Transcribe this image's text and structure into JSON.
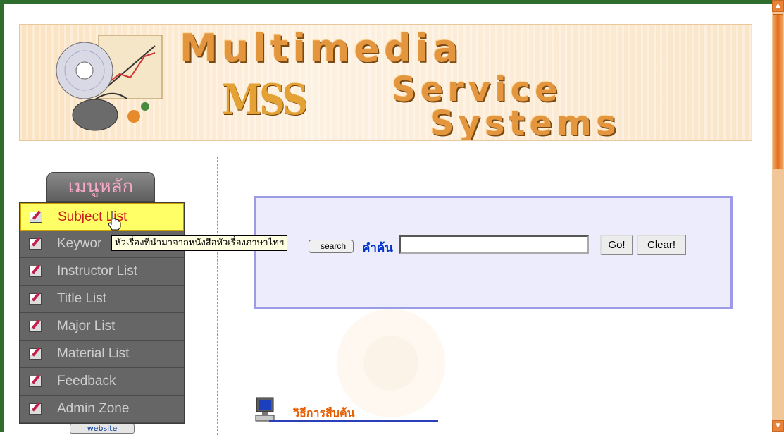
{
  "banner": {
    "word_multimedia": "Multimedia",
    "word_service": "Service",
    "word_systems": "Systems",
    "word_mss": "MSS"
  },
  "sidebar": {
    "heading": "เมนูหลัก",
    "items": [
      {
        "label": "Subject List",
        "active": true
      },
      {
        "label": "Keywor",
        "active": false
      },
      {
        "label": "Instructor List",
        "active": false
      },
      {
        "label": "Title List",
        "active": false
      },
      {
        "label": "Major List",
        "active": false
      },
      {
        "label": "Material List",
        "active": false
      },
      {
        "label": "Feedback",
        "active": false
      },
      {
        "label": "Admin Zone",
        "active": false
      }
    ],
    "website_button": "website"
  },
  "tooltip": {
    "text": "หัวเรื่องที่นำมาจากหนังสือหัวเรื่องภาษาไทย"
  },
  "search": {
    "search_button": "search",
    "label": "คำค้น",
    "input_value": "",
    "go_label": "Go!",
    "clear_label": "Clear!"
  },
  "howto": {
    "title": "วิธีการสืบค้น"
  },
  "colors": {
    "frame": "#2f6d2f",
    "menu_active_bg": "#ffff66",
    "menu_active_text": "#cc1b1b",
    "search_panel_border": "#9b9be6",
    "scrollbar": "#e06e1c"
  }
}
